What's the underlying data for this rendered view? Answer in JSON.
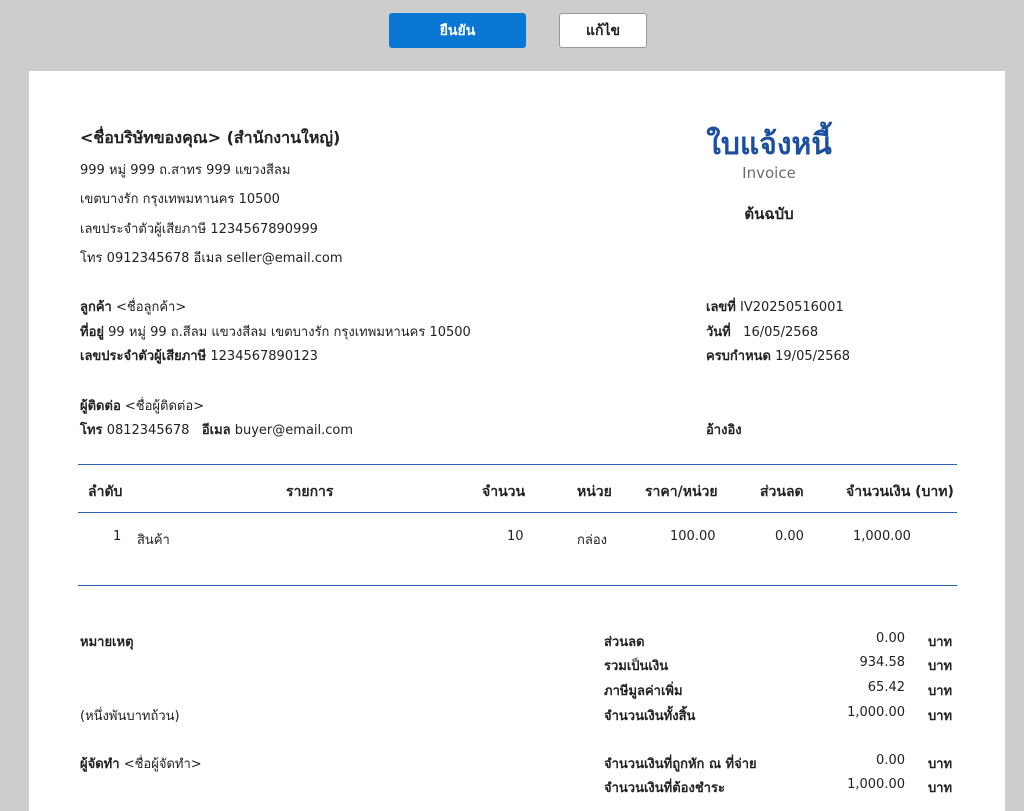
{
  "toolbar": {
    "confirm_label": "ยืนยัน",
    "edit_label": "แก้ไข"
  },
  "seller": {
    "name": "<ชื่อบริษัทของคุณ> (สำนักงานใหญ่)",
    "address1": "999 หมู่ 999 ถ.สาทร 999 แขวงสีลม",
    "address2": "เขตบางรัก  กรุงเทพมหานคร 10500",
    "tax_line": "เลขประจำตัวผู้เสียภาษี 1234567890999",
    "contact_line": "โทร 0912345678  อีเมล seller@email.com"
  },
  "document": {
    "title": "ใบแจ้งหนี้",
    "subtitle": "Invoice",
    "copy": "ต้นฉบับ"
  },
  "customer": {
    "name_label": "ลูกค้า",
    "name_value": "<ชื่อลูกค้า>",
    "address_label": "ที่อยู่",
    "address_value": "99 หมู่ 99 ถ.สีลม แขวงสีลม เขตบางรัก กรุงเทพมหานคร 10500",
    "tax_label": "เลขประจำตัวผู้เสียภาษี",
    "tax_value": "1234567890123",
    "contact_label": "ผู้ติดต่อ",
    "contact_value": "<ชื่อผู้ติดต่อ>",
    "phone_label": "โทร",
    "phone_value": "0812345678",
    "email_label": "อีเมล",
    "email_value": "buyer@email.com"
  },
  "meta": {
    "number_label": "เลขที่",
    "number_value": "IV20250516001",
    "date_label": "วันที่",
    "date_value": "16/05/2568",
    "due_label": "ครบกำหนด",
    "due_value": "19/05/2568",
    "reference_label": "อ้างอิง"
  },
  "table": {
    "headers": [
      "ลำดับ",
      "รายการ",
      "จำนวน",
      "หน่วย",
      "ราคา/หน่วย",
      "ส่วนลด",
      "จำนวนเงิน (บาท)"
    ],
    "rows": [
      {
        "no": "1",
        "item": "สินค้า",
        "qty": "10",
        "unit": "กล่อง",
        "price": "100.00",
        "discount": "0.00",
        "amount": "1,000.00"
      }
    ]
  },
  "notes": {
    "label": "หมายเหตุ",
    "amount_text": "(หนึ่งพันบาทถ้วน)",
    "preparer_label": "ผู้จัดทำ",
    "preparer_value": "<ชื่อผู้จัดทำ>"
  },
  "summary": {
    "discount_label": "ส่วนลด",
    "discount_value": "0.00",
    "subtotal_label": "รวมเป็นเงิน",
    "subtotal_value": "934.58",
    "vat_label": "ภาษีมูลค่าเพิ่ม",
    "vat_value": "65.42",
    "total_label": "จำนวนเงินทั้งสิ้น",
    "total_value": "1,000.00",
    "withholding_label": "จำนวนเงินที่ถูกหัก ณ ที่จ่าย",
    "withholding_value": "0.00",
    "payable_label": "จำนวนเงินที่ต้องชำระ",
    "payable_value": "1,000.00",
    "currency": "บาท"
  }
}
